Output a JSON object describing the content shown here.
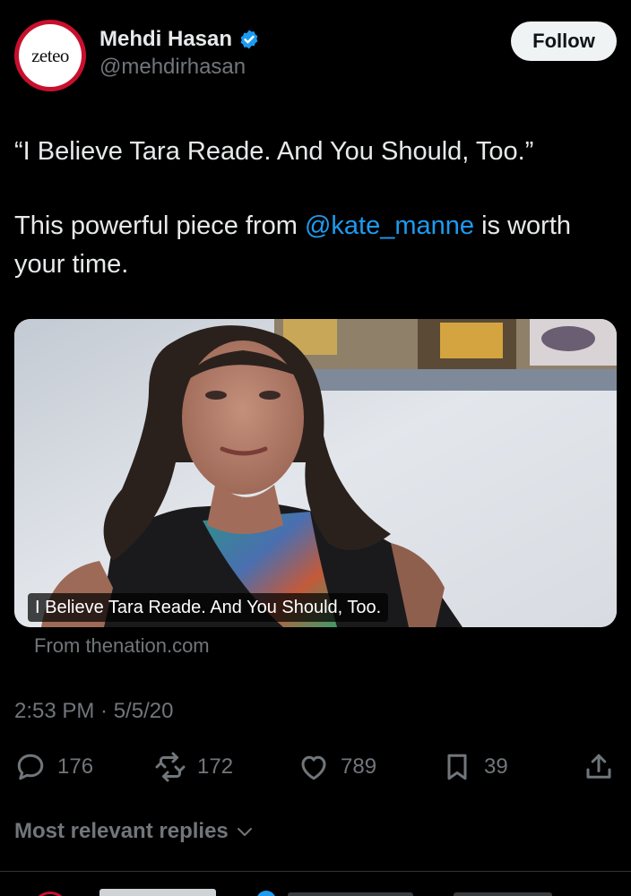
{
  "author": {
    "avatar_text": "zeteo",
    "display_name": "Mehdi Hasan",
    "handle": "@mehdirhasan",
    "verified": true
  },
  "follow_label": "Follow",
  "tweet": {
    "line1": "“I Believe Tara Reade. And You Should, Too.”",
    "line2_prefix": "This powerful piece from ",
    "mention": "@kate_manne",
    "line2_suffix": " is worth your time."
  },
  "media": {
    "caption": "I Believe Tara Reade. And You Should, Too.",
    "source": "From thenation.com"
  },
  "timestamp": "2:53 PM · 5/5/20",
  "actions": {
    "replies": "176",
    "reposts": "172",
    "likes": "789",
    "bookmarks": "39"
  },
  "replies_sort_label": "Most relevant replies",
  "colors": {
    "accent": "#1d9bf0",
    "muted": "#71767b",
    "background": "#000000",
    "brand_red": "#c8102e"
  },
  "icons": [
    "verified-badge-icon",
    "reply-icon",
    "repost-icon",
    "like-icon",
    "bookmark-icon",
    "share-icon",
    "chevron-down-icon"
  ]
}
